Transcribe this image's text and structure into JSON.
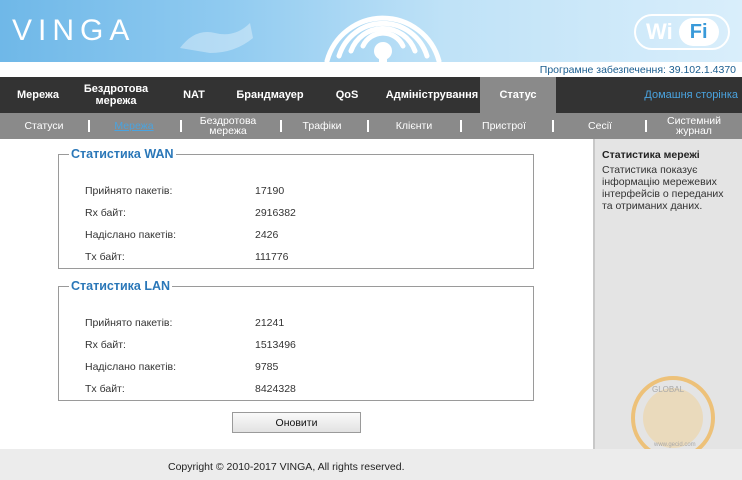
{
  "banner": {
    "logo": "VINGA",
    "wifi_wi": "Wi",
    "wifi_fi": "Fi"
  },
  "firmware": "Програмне забезпечення: 39.102.1.4370",
  "topnav": {
    "items": [
      "Мережа",
      "Бездротова мережа",
      "NAT",
      "Брандмауер",
      "QoS",
      "Адміністрування",
      "Статус"
    ],
    "active": "Статус",
    "home_link": "Домашня сторінка"
  },
  "subnav": {
    "items": [
      "Статуси",
      "Мережа",
      "Бездротова мережа",
      "Трафіки",
      "Клієнти",
      "Пристрої",
      "Сесії",
      "Системний журнал"
    ],
    "active": "Мережа"
  },
  "wan": {
    "title": "Статистика WAN",
    "rows": [
      {
        "label": "Прийнято пакетів:",
        "value": "17190"
      },
      {
        "label": "Rx байт:",
        "value": "2916382"
      },
      {
        "label": "Надіслано пакетів:",
        "value": "2426"
      },
      {
        "label": "Tx байт:",
        "value": "111776"
      }
    ]
  },
  "lan": {
    "title": "Статистика LAN",
    "rows": [
      {
        "label": "Прийнято пакетів:",
        "value": "21241"
      },
      {
        "label": "Rx байт:",
        "value": "1513496"
      },
      {
        "label": "Надіслано пакетів:",
        "value": "9785"
      },
      {
        "label": "Tx байт:",
        "value": "8424328"
      }
    ]
  },
  "refresh_label": "Оновити",
  "help": {
    "title": "Статистика мережі",
    "text": "Статистика показує інформацію мережевих інтерфейсів о переданих та отриманих даних."
  },
  "footer": "Copyright © 2010-2017 VINGA, All rights reserved.",
  "watermark": {
    "top": "GLOBAL",
    "site": "www.gecid.com",
    "accent": "#f5a623"
  },
  "colors": {
    "topnav_bg": "#333333",
    "subnav_bg": "#8a8a8a",
    "accent": "#2a77b8",
    "link": "#4aa3df"
  }
}
